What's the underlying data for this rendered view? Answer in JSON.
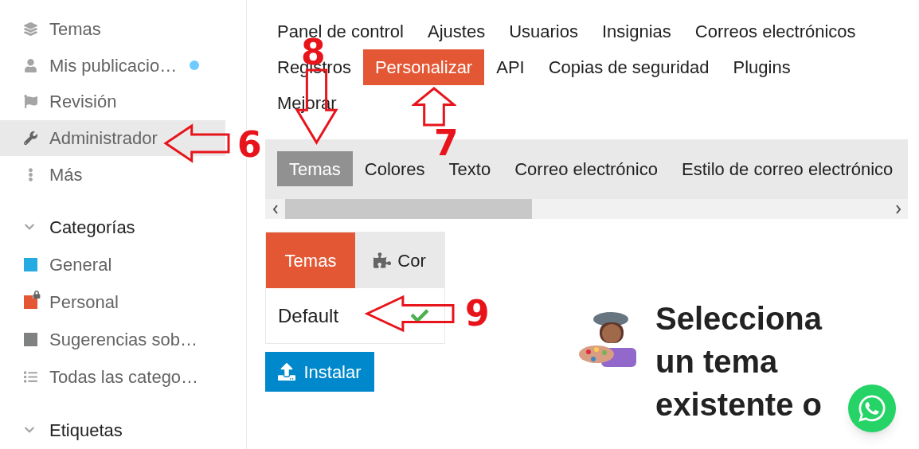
{
  "sidebar": {
    "items": [
      {
        "label": "Temas",
        "selected": false,
        "unread": false
      },
      {
        "label": "Mis publicacio…",
        "selected": false,
        "unread": true
      },
      {
        "label": "Revisión",
        "selected": false,
        "unread": false
      },
      {
        "label": "Administrador",
        "selected": true,
        "unread": false
      },
      {
        "label": "Más",
        "selected": false,
        "unread": false
      }
    ],
    "sections": [
      {
        "title": "Categorías",
        "expanded": true,
        "items": [
          {
            "kind": "category",
            "label": "General",
            "color": "#25aae1",
            "locked": false
          },
          {
            "kind": "category",
            "label": "Personal",
            "color": "#e45735",
            "locked": true
          },
          {
            "kind": "category",
            "label": "Sugerencias sob…",
            "color": "#808281",
            "locked": false
          },
          {
            "kind": "all",
            "label": "Todas las catego…"
          }
        ]
      },
      {
        "title": "Etiquetas",
        "expanded": true
      }
    ]
  },
  "admin_nav": [
    {
      "label": "Panel de control",
      "selected": false
    },
    {
      "label": "Ajustes",
      "selected": false
    },
    {
      "label": "Usuarios",
      "selected": false
    },
    {
      "label": "Insignias",
      "selected": false
    },
    {
      "label": "Correos electrónicos",
      "selected": false
    },
    {
      "label": "Registros",
      "selected": false
    },
    {
      "label": "Personalizar",
      "selected": true
    },
    {
      "label": "API",
      "selected": false
    },
    {
      "label": "Copias de seguridad",
      "selected": false
    },
    {
      "label": "Plugins",
      "selected": false
    },
    {
      "label": "Mejorar",
      "selected": false
    }
  ],
  "sub_nav": [
    {
      "label": "Temas",
      "selected": true
    },
    {
      "label": "Colores",
      "selected": false
    },
    {
      "label": "Texto",
      "selected": false
    },
    {
      "label": "Correo electrónico",
      "selected": false
    },
    {
      "label": "Estilo de correo electrónico",
      "selected": false
    }
  ],
  "theme_tabs": [
    {
      "label": "Temas",
      "selected": true
    },
    {
      "label": "Cor",
      "selected": false
    }
  ],
  "themes": [
    {
      "name": "Default",
      "default": true
    }
  ],
  "install_button": "Instalar",
  "heading": "Selecciona un tema existente o",
  "annotations": [
    {
      "label": "6",
      "kind": "left-arrow"
    },
    {
      "label": "7",
      "kind": "up-arrow"
    },
    {
      "label": "8",
      "kind": "down-arrow"
    },
    {
      "label": "9",
      "kind": "left-arrow"
    }
  ]
}
